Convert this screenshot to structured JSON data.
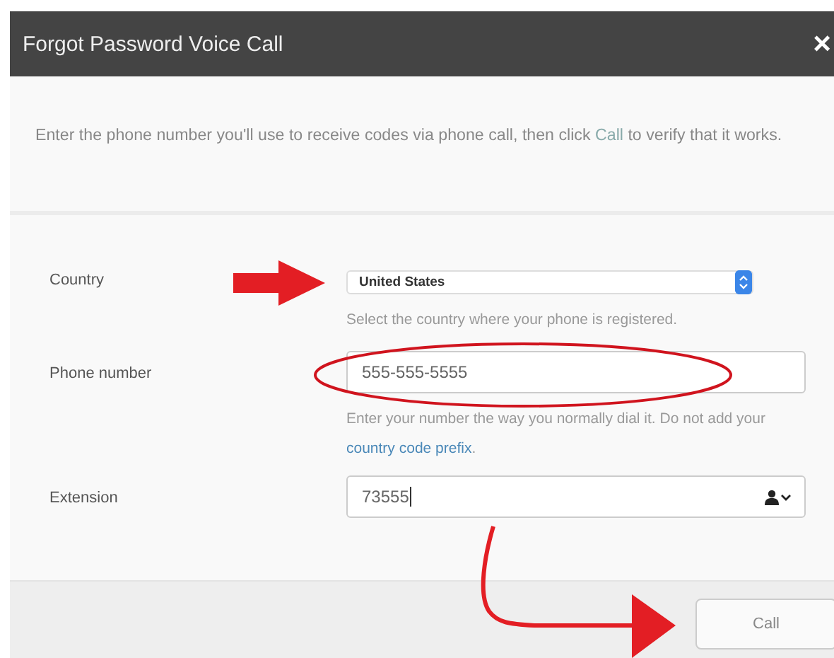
{
  "dialog": {
    "title": "Forgot Password Voice Call",
    "close": "×"
  },
  "intro": {
    "text_before": "Enter the phone number you'll use to receive codes via phone call, then click ",
    "link": "Call",
    "text_after": " to verify that it works."
  },
  "fields": [
    {
      "kind": "select",
      "label": "Country",
      "value": "United States",
      "hint": "Select the country where your phone is registered."
    },
    {
      "kind": "text",
      "label": "Phone number",
      "value": "555-555-5555",
      "hint": "Enter your number the way you normally dial it. Do not add your ",
      "hint_link": "country code prefix",
      "hint_after": "."
    },
    {
      "kind": "contact",
      "label": "Extension",
      "value": "73555"
    }
  ],
  "buttons": [
    {
      "label": "Call"
    }
  ],
  "annotations": [
    {
      "kind": "arrow",
      "color": "#e31e24"
    },
    {
      "kind": "ellipse",
      "color": "#d0141e"
    },
    {
      "kind": "curved-arrow",
      "color": "#e31e24"
    }
  ]
}
